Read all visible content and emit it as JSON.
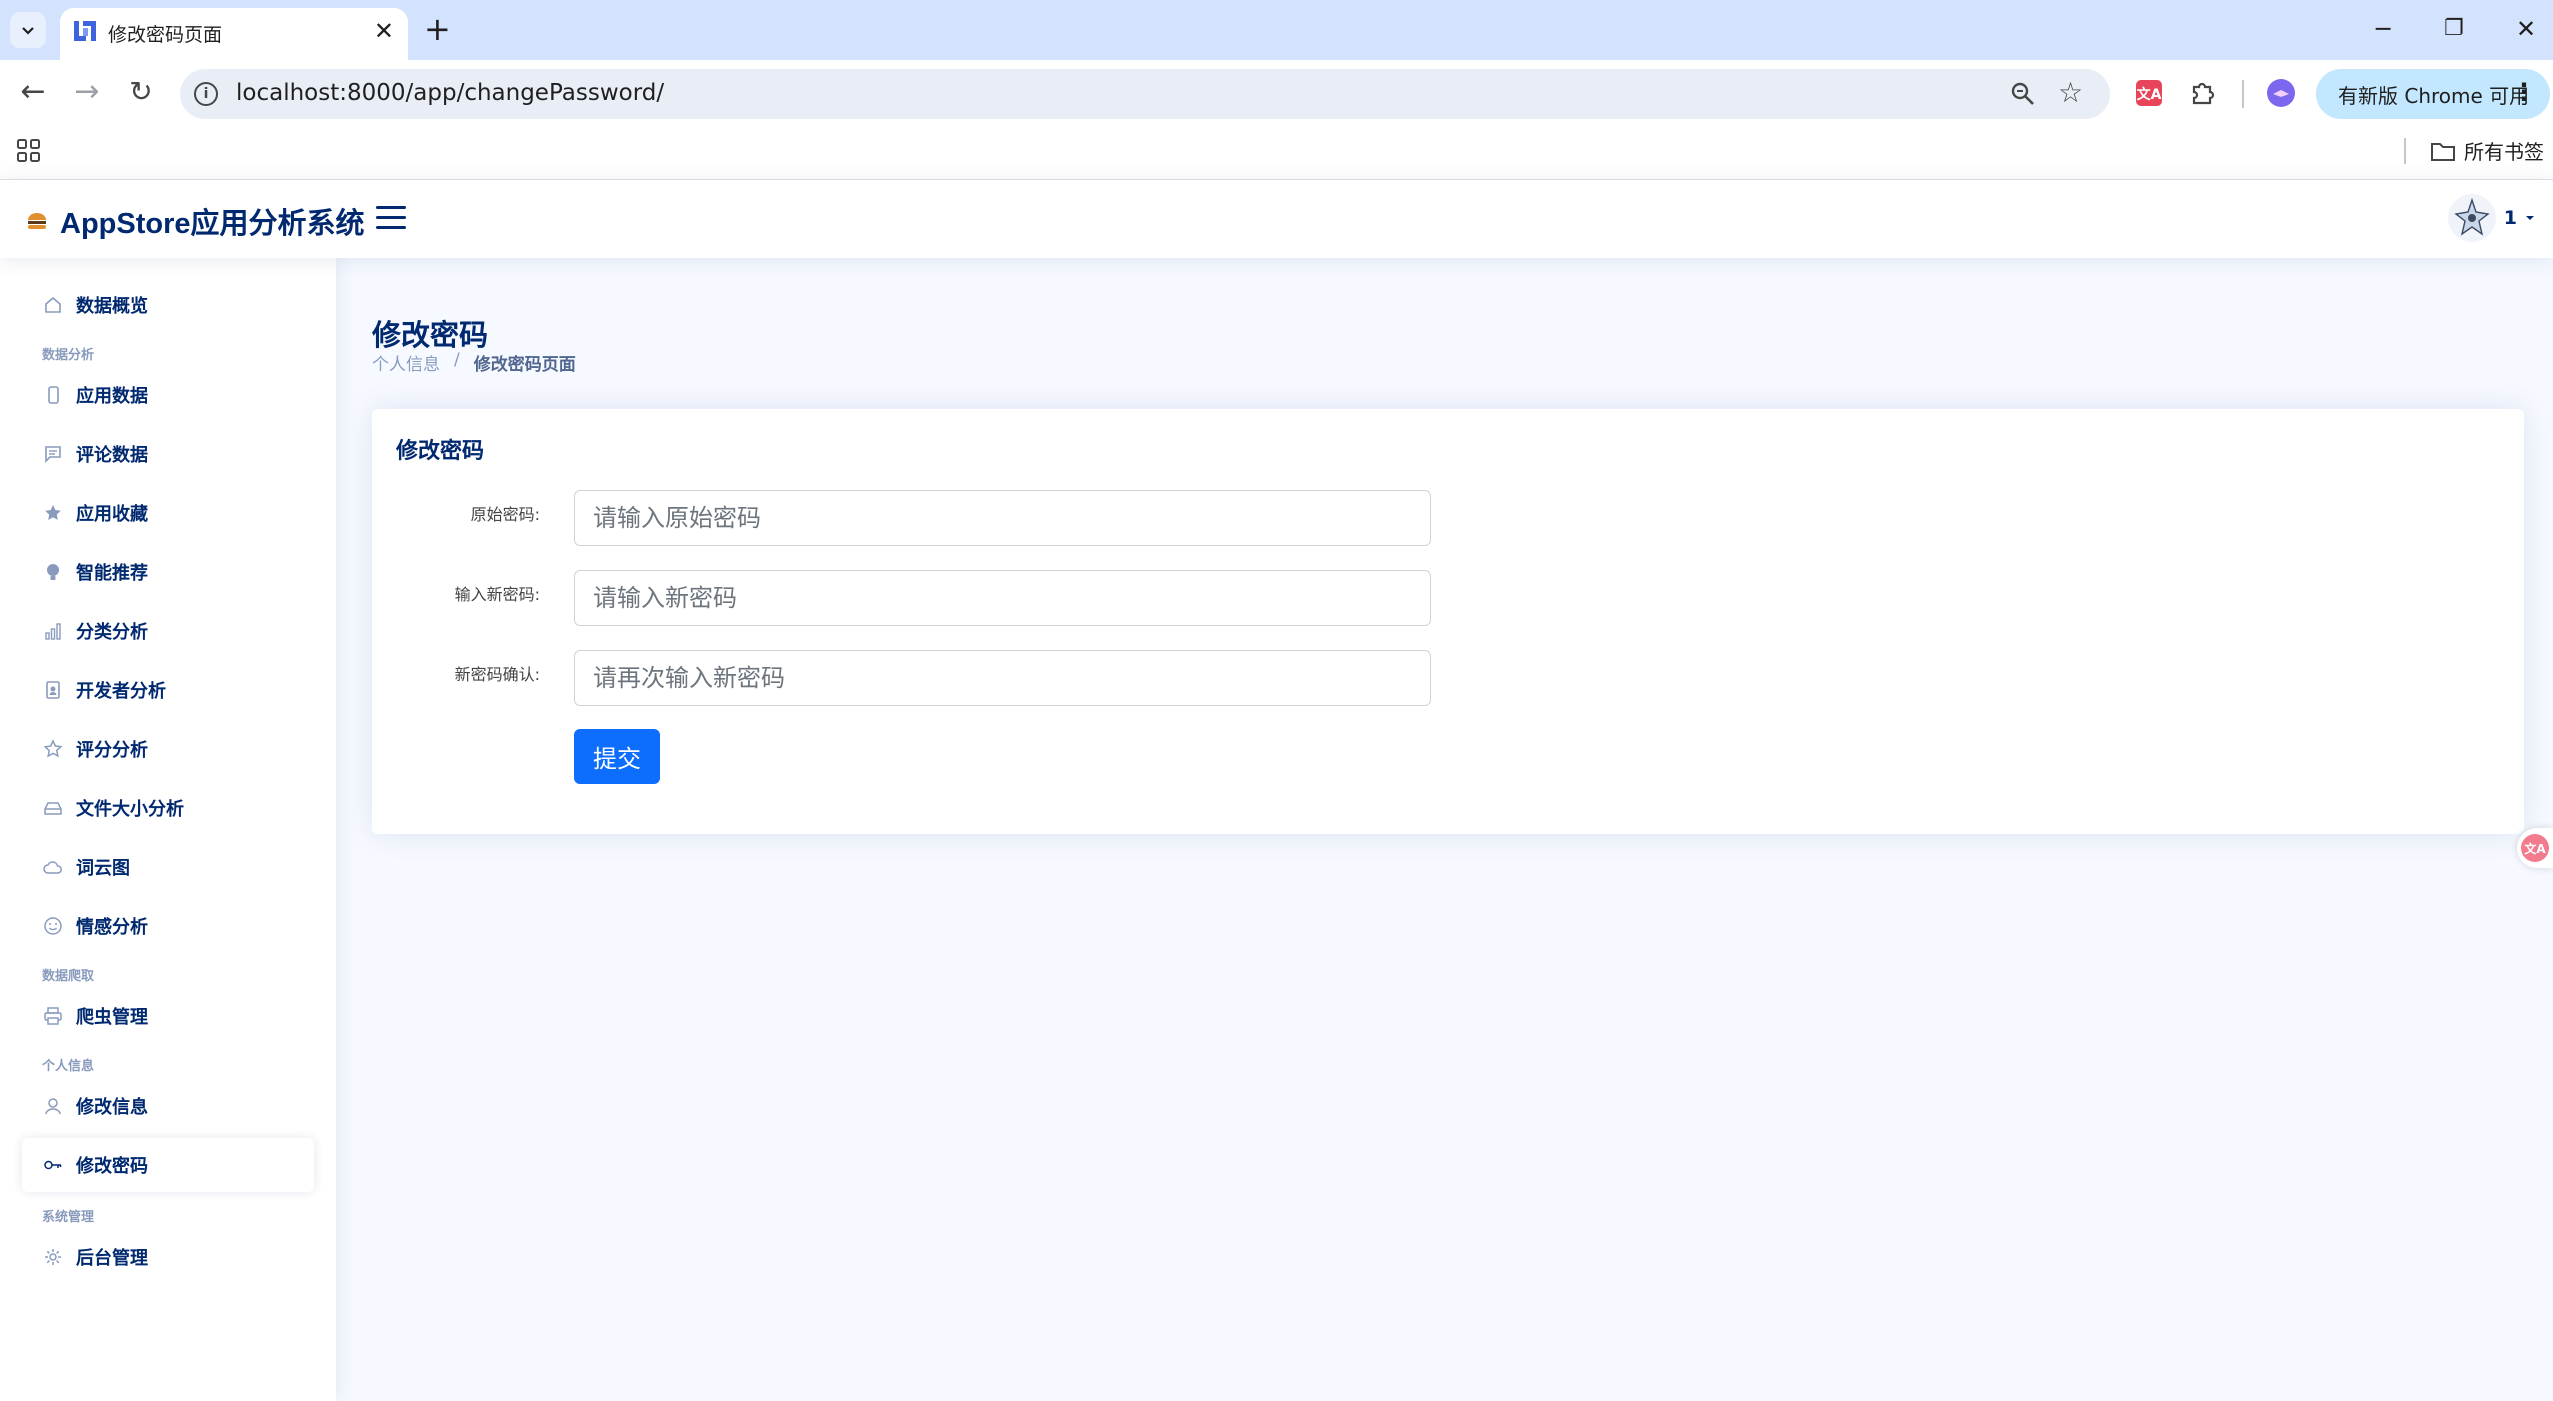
{
  "browser": {
    "tab_title": "修改密码页面",
    "url": "localhost:8000/app/changePassword/",
    "update_button": "有新版 Chrome 可用",
    "bookmarks_folder": "所有书签"
  },
  "app": {
    "brand": "AppStore应用分析系统",
    "user_name": "1"
  },
  "sidebar": {
    "items": [
      {
        "type": "item",
        "label": "数据概览",
        "icon": "house-icon"
      },
      {
        "type": "heading",
        "label": "数据分析"
      },
      {
        "type": "item",
        "label": "应用数据",
        "icon": "phone-icon"
      },
      {
        "type": "item",
        "label": "评论数据",
        "icon": "chat-icon"
      },
      {
        "type": "item",
        "label": "应用收藏",
        "icon": "star-fill-icon"
      },
      {
        "type": "item",
        "label": "智能推荐",
        "icon": "lightbulb-icon"
      },
      {
        "type": "item",
        "label": "分类分析",
        "icon": "bar-chart-icon"
      },
      {
        "type": "item",
        "label": "开发者分析",
        "icon": "person-badge-icon"
      },
      {
        "type": "item",
        "label": "评分分析",
        "icon": "star-icon"
      },
      {
        "type": "item",
        "label": "文件大小分析",
        "icon": "hdd-icon"
      },
      {
        "type": "item",
        "label": "词云图",
        "icon": "cloud-icon"
      },
      {
        "type": "item",
        "label": "情感分析",
        "icon": "emoji-icon"
      },
      {
        "type": "heading",
        "label": "数据爬取"
      },
      {
        "type": "item",
        "label": "爬虫管理",
        "icon": "printer-icon"
      },
      {
        "type": "heading",
        "label": "个人信息"
      },
      {
        "type": "item",
        "label": "修改信息",
        "icon": "person-icon"
      },
      {
        "type": "item",
        "label": "修改密码",
        "icon": "key-icon",
        "active": true
      },
      {
        "type": "heading",
        "label": "系统管理"
      },
      {
        "type": "item",
        "label": "后台管理",
        "icon": "gear-icon"
      }
    ]
  },
  "page": {
    "title": "修改密码",
    "breadcrumb": [
      "个人信息",
      "修改密码页面"
    ],
    "breadcrumb_sep": "/"
  },
  "form": {
    "card_title": "修改密码",
    "fields": [
      {
        "label": "原始密码:",
        "placeholder": "请输入原始密码"
      },
      {
        "label": "输入新密码:",
        "placeholder": "请输入新密码"
      },
      {
        "label": "新密码确认:",
        "placeholder": "请再次输入新密码"
      }
    ],
    "submit_label": "提交"
  }
}
